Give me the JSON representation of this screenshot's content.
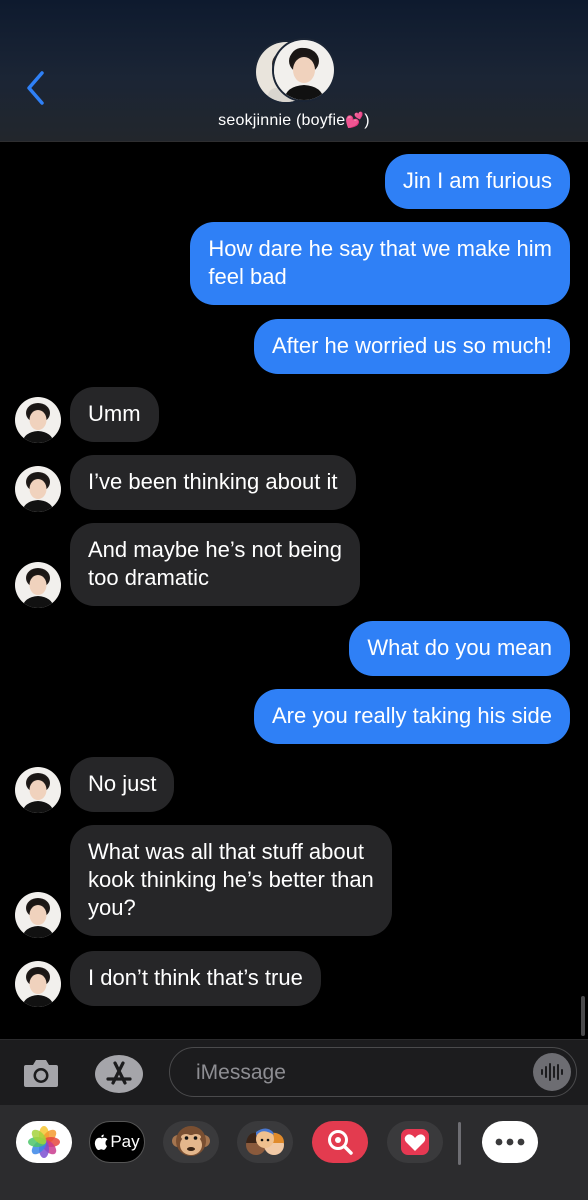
{
  "header": {
    "contact_name": "seokjinnie (boyfie",
    "heart": "💕",
    "name_suffix": ")"
  },
  "messages": [
    {
      "from": "me",
      "text": "Jin I am furious"
    },
    {
      "from": "me",
      "text": "How dare he say that we make him\nfeel bad"
    },
    {
      "from": "me",
      "text": "After he worried us so much!"
    },
    {
      "from": "contact",
      "text": "Umm"
    },
    {
      "from": "contact",
      "text": "I’ve been thinking about it"
    },
    {
      "from": "contact",
      "text": "And maybe he’s not being\ntoo dramatic"
    },
    {
      "from": "me",
      "text": "What do you mean"
    },
    {
      "from": "me",
      "text": "Are you really taking his side"
    },
    {
      "from": "contact",
      "text": "No just"
    },
    {
      "from": "contact",
      "text": "What was all that stuff about\nkook thinking he’s better than\nyou?"
    },
    {
      "from": "contact",
      "text": "I don’t think that’s true"
    }
  ],
  "compose": {
    "placeholder": "iMessage"
  },
  "app_bar": {
    "apps": [
      "photos-icon",
      "apple-pay-icon",
      "monkey-animoji-icon",
      "memoji-icon",
      "image-search-icon",
      "heart-sticker-icon",
      "more-icon"
    ],
    "apple_pay_label": "Pay"
  },
  "colors": {
    "sent_bubble": "#2f80f6",
    "received_bubble": "#262628",
    "accent": "#2f80f6"
  }
}
